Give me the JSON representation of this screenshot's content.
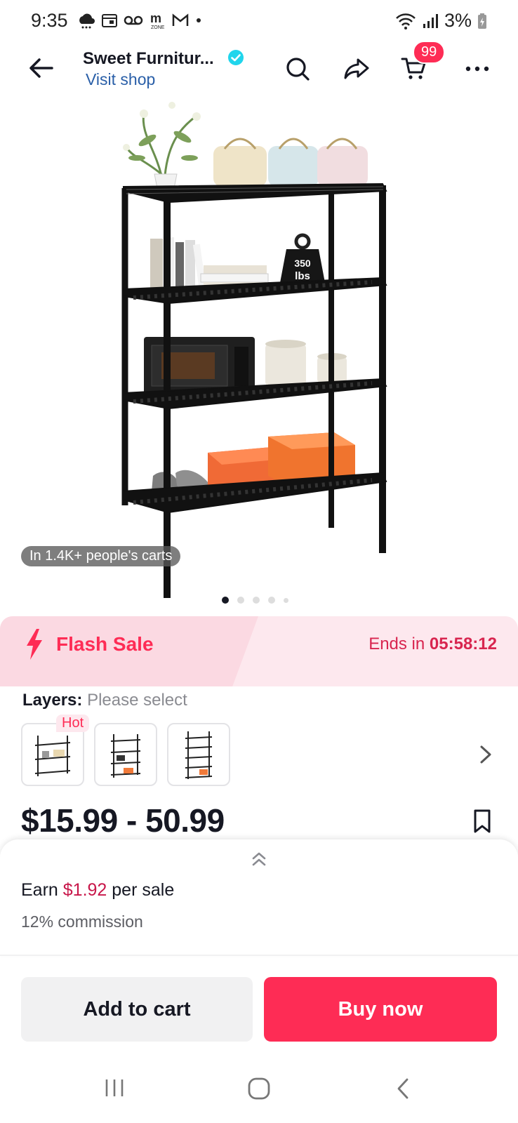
{
  "status_bar": {
    "time": "9:35",
    "battery": "3%"
  },
  "header": {
    "shop_name": "Sweet Furnitur...",
    "visit_shop": "Visit shop",
    "cart_badge": "99"
  },
  "product": {
    "social_proof": "In 1.4K+ people's carts",
    "image_count": 5,
    "active_image": 1
  },
  "flash_sale": {
    "label": "Flash Sale",
    "ends_prefix": "Ends in",
    "countdown": "05:58:12"
  },
  "variants": {
    "label": "Layers:",
    "value": "Please select",
    "hot_tag": "Hot"
  },
  "price": {
    "range": "$15.99 - 50.99"
  },
  "commission": {
    "earn_prefix": "Earn",
    "amount": "$1.92",
    "earn_suffix": "per sale",
    "rate_text": "12% commission"
  },
  "actions": {
    "add_to_cart": "Add to cart",
    "buy_now": "Buy now"
  },
  "colors": {
    "accent": "#fe2c55",
    "flash_bg": "#fde8ee",
    "link": "#2a5fa8"
  }
}
